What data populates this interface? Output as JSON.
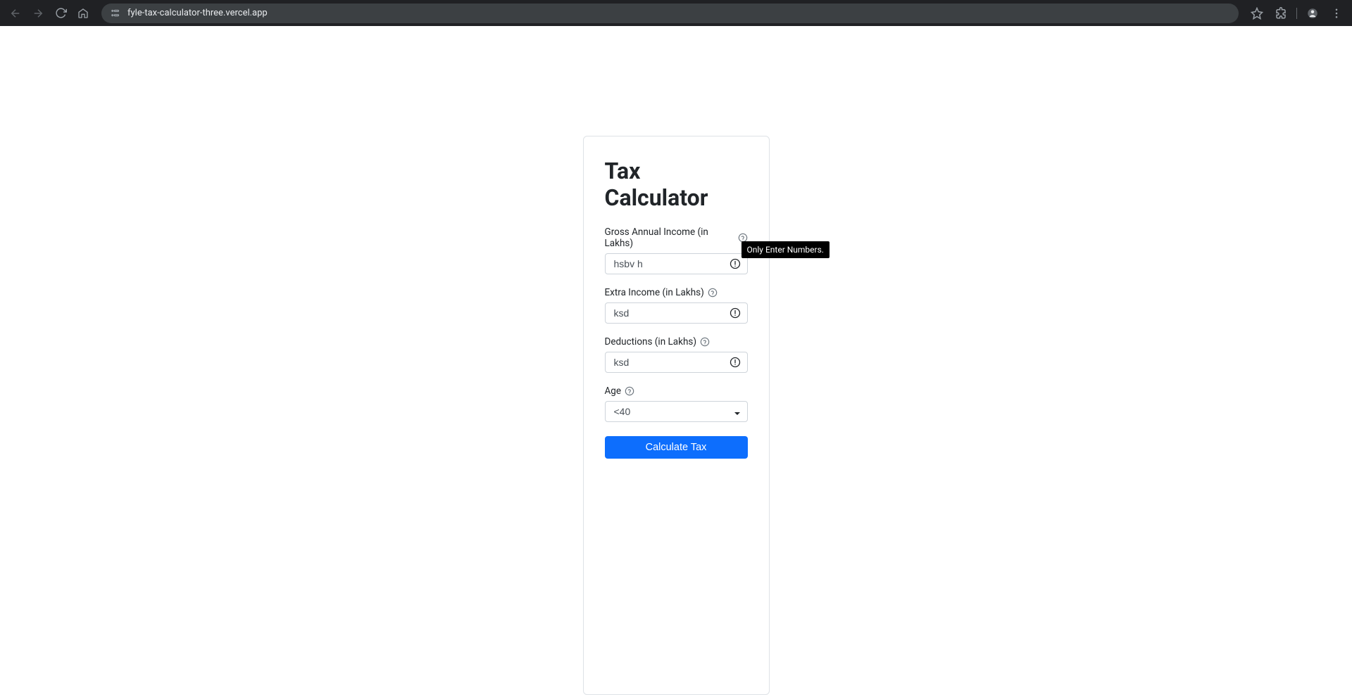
{
  "browser": {
    "url": "fyle-tax-calculator-three.vercel.app"
  },
  "card": {
    "title": "Tax Calculator",
    "fields": {
      "gross": {
        "label": "Gross Annual Income (in Lakhs)",
        "value": "hsbv h"
      },
      "extra": {
        "label": "Extra Income (in Lakhs)",
        "value": "ksd"
      },
      "deductions": {
        "label": "Deductions (in Lakhs)",
        "value": "ksd"
      },
      "age": {
        "label": "Age",
        "value": "<40"
      }
    },
    "submit_label": "Calculate Tax"
  },
  "tooltip": {
    "text": "Only Enter Numbers."
  }
}
